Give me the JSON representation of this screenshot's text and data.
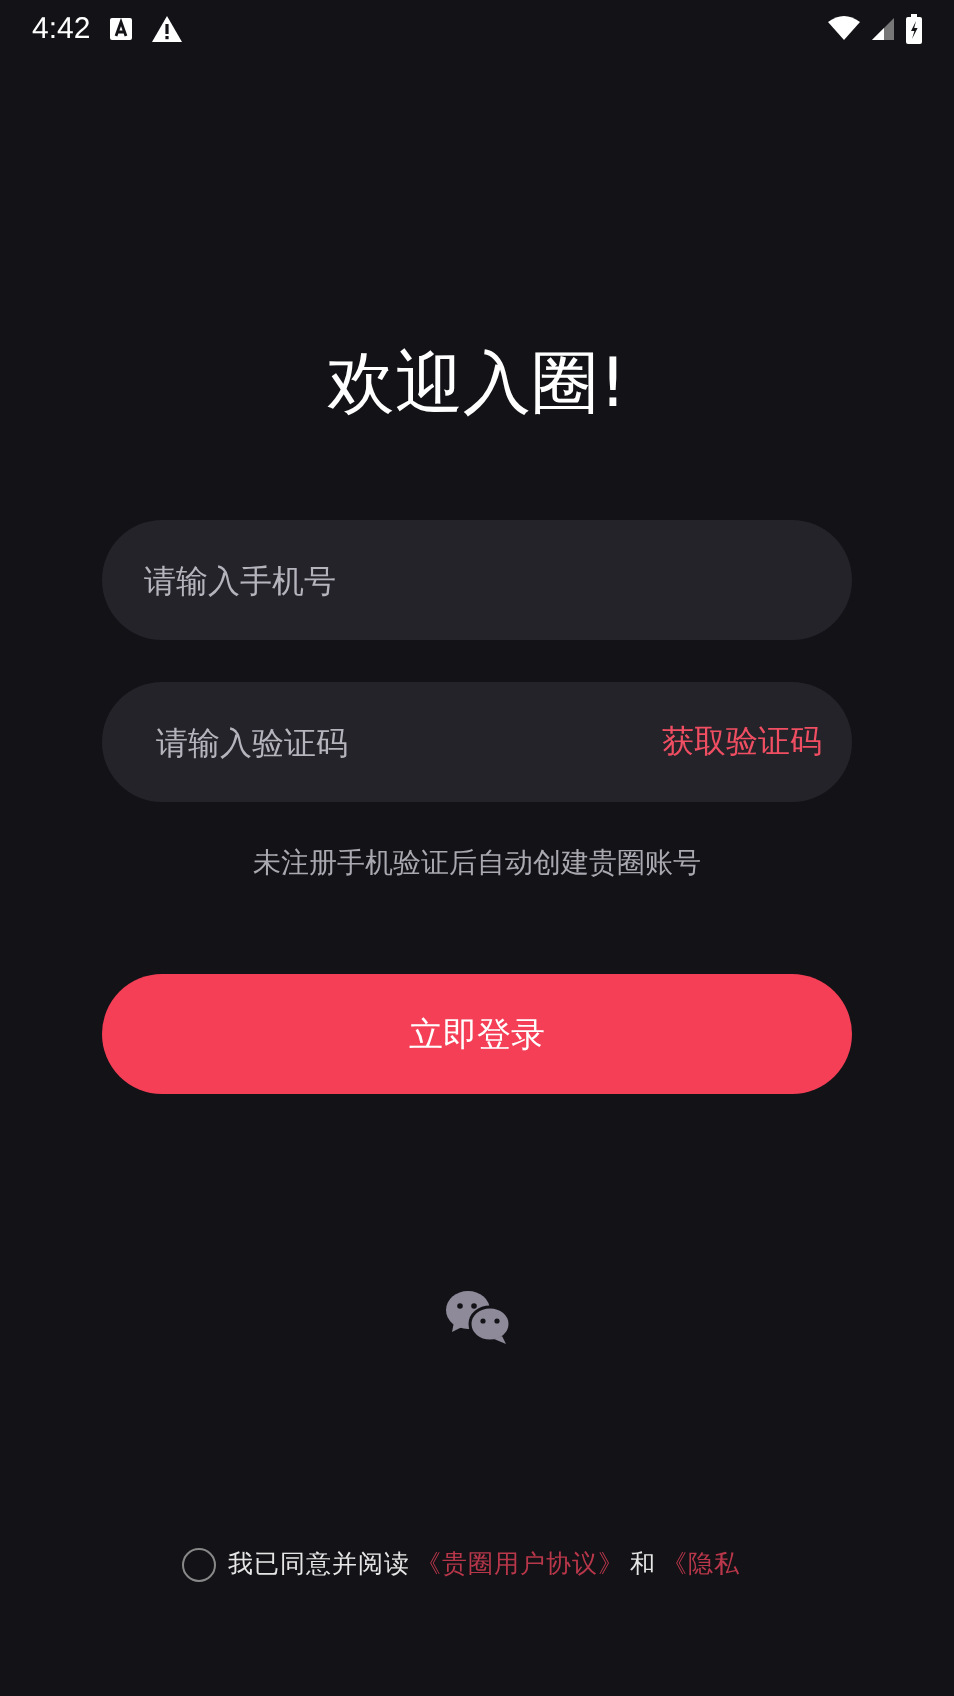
{
  "status_bar": {
    "time": "4:42"
  },
  "title": "欢迎入圈!",
  "phone_field": {
    "placeholder": "请输入手机号"
  },
  "code_field": {
    "placeholder": "请输入验证码",
    "action": "获取验证码"
  },
  "hint": "未注册手机验证后自动创建贵圈账号",
  "login_button": "立即登录",
  "agreement": {
    "checked": false,
    "text": "我已同意并阅读",
    "links": [
      "《贵圈用户协议》",
      "《隐私"
    ],
    "joiner": "和"
  }
}
